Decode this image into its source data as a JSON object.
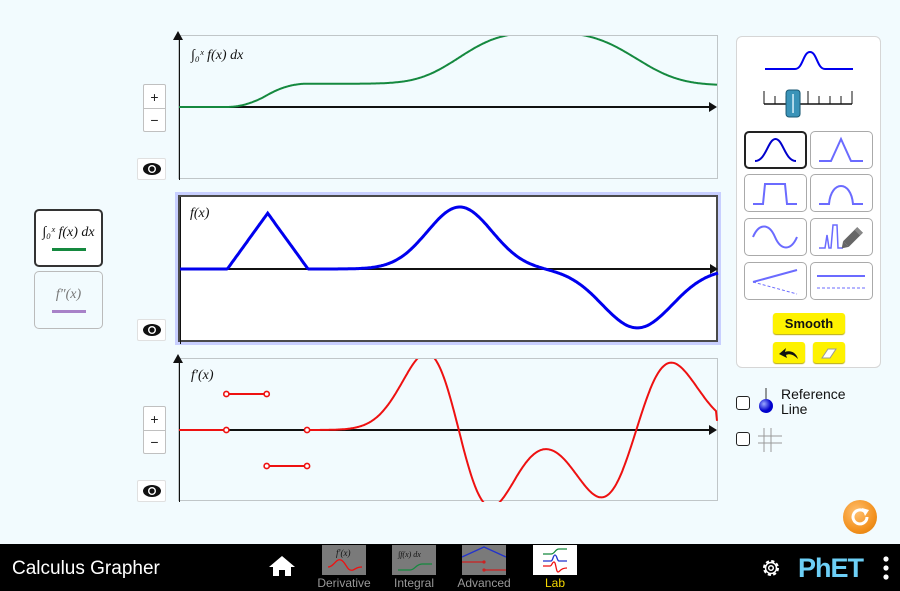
{
  "app": {
    "title": "Calculus Grapher",
    "nav_tabs": [
      {
        "label": "Derivative",
        "active": false
      },
      {
        "label": "Integral",
        "active": false
      },
      {
        "label": "Advanced",
        "active": false
      },
      {
        "label": "Lab",
        "active": true
      }
    ],
    "logo_text": "PhET"
  },
  "icons": {
    "home": "home-icon",
    "settings": "gear-icon",
    "menu": "vertical-dots-icon",
    "reset": "reset-all-icon",
    "eye": "eye-icon",
    "undo": "undo-arrow-icon",
    "eraser": "eraser-icon",
    "pencil": "pencil-icon",
    "grid": "grid-icon"
  },
  "colors": {
    "integral": "#15893f",
    "function": "#0000ee",
    "derivative": "#ee1111",
    "second_derivative": "#a882c8",
    "accent_yellow": "#fef200",
    "reset_orange": "#f39220",
    "phet_blue": "#6dcff6"
  },
  "curve_toggles": [
    {
      "label": "∫₀ˣ f(x) dx",
      "selected": true
    },
    {
      "label": "f″(x)",
      "selected": false
    }
  ],
  "graphs": [
    {
      "title": "∫₀ˣ f(x) dx",
      "zoom_plus": "+",
      "zoom_minus": "−",
      "visible": true
    },
    {
      "title": "f(x)",
      "visible": true
    },
    {
      "title": "f′(x)",
      "zoom_plus": "+",
      "zoom_minus": "−",
      "visible": true
    }
  ],
  "control_panel": {
    "width_slider_value": 0.33,
    "shapes": [
      {
        "name": "gaussian",
        "selected": true
      },
      {
        "name": "triangle",
        "selected": false
      },
      {
        "name": "pedestal",
        "selected": false
      },
      {
        "name": "parabola",
        "selected": false
      },
      {
        "name": "sinusoid",
        "selected": false
      },
      {
        "name": "freeform",
        "selected": false
      },
      {
        "name": "tilt",
        "selected": false
      },
      {
        "name": "shift",
        "selected": false
      }
    ],
    "smooth_label": "Smooth"
  },
  "checkboxes": [
    {
      "label": "Reference Line",
      "checked": false
    },
    {
      "label": "",
      "icon": "grid-icon",
      "checked": false
    }
  ],
  "chart_data": [
    {
      "type": "line",
      "title": "∫₀ˣ f(x) dx",
      "x_range": [
        0,
        1
      ],
      "series": [
        {
          "name": "integral",
          "color": "#15893f"
        }
      ],
      "grid": false
    },
    {
      "type": "line",
      "title": "f(x)",
      "series": [
        {
          "name": "f",
          "color": "#0000ee",
          "features": [
            "triangle peak near x=0.16",
            "gaussian peak near x=0.52",
            "negative trough near x=0.85"
          ]
        }
      ],
      "grid": false
    },
    {
      "type": "line",
      "title": "f′(x)",
      "series": [
        {
          "name": "derivative",
          "color": "#ee1111",
          "features": [
            "piecewise constant steps with open endpoints on triangle",
            "smooth oscillation afterwards"
          ]
        }
      ],
      "grid": false
    }
  ]
}
